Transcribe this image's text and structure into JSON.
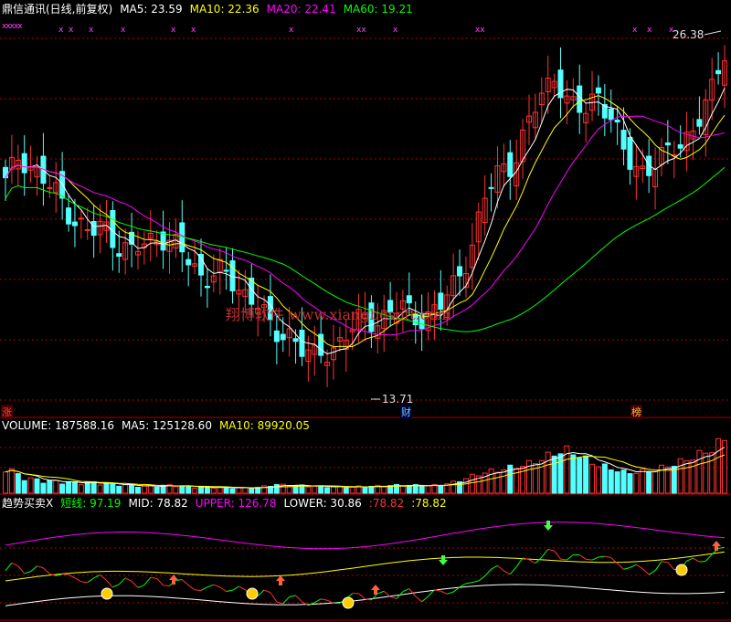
{
  "colors": {
    "bg": "#000000",
    "up": "#ff3232",
    "down": "#54ffff",
    "ma5": "#ffffff",
    "ma10": "#ffff00",
    "ma20": "#ff00ff",
    "ma60": "#00ff00",
    "grid": "#b00000",
    "label": "#d0d0d0",
    "wm": "#c03030"
  },
  "header": {
    "name": "鼎信通讯(日线,前复权)",
    "ma5": "MA5: 23.59",
    "ma10": "MA10: 22.36",
    "ma20": "MA20: 22.41",
    "ma60": "MA60: 19.21"
  },
  "markers": {
    "top_left": "xxxxx",
    "x_marks": [
      "x",
      "x",
      "x",
      "x",
      "x",
      "x",
      "x",
      "xx",
      "x",
      "xx",
      "x",
      "x",
      "x"
    ]
  },
  "price_annotations": {
    "high": "26.38",
    "low": "13.71"
  },
  "event_flags": {
    "zhang": "涨",
    "cai": "财",
    "bang": "榜"
  },
  "watermark": "翔博软件 www.xiangbosoft.com",
  "volume_header": {
    "volume": "VOLUME: 187588.16",
    "ma5": "MA5: 125128.60",
    "ma10": "MA10: 89920.05"
  },
  "indicator_header": {
    "name": "趋势买卖X",
    "short": "短线: 97.19",
    "mid": "MID: 78.82",
    "upper": "UPPER: 126.78",
    "lower": "LOWER: 30.86",
    "v1": ":78.82",
    "v2": ":78.82"
  },
  "chart_data": [
    {
      "type": "candlestick",
      "title": "鼎信通讯(日线,前复权)",
      "ylim": [
        12.5,
        27.5
      ],
      "ma_values": {
        "MA5": 23.59,
        "MA10": 22.36,
        "MA20": 22.41,
        "MA60": 19.21
      },
      "series_close_approx": [
        21.2,
        22.4,
        21.8,
        21.1,
        20.6,
        19.8,
        19.2,
        19.6,
        18.9,
        18.5,
        18.9,
        19.3,
        18.8,
        18.2,
        17.6,
        17.9,
        17.3,
        17.0,
        16.7,
        15.1,
        15.6,
        14.9,
        14.3,
        14.8,
        15.3,
        15.8,
        15.9,
        16.2,
        16.4,
        16.0,
        16.2,
        16.5,
        17.4,
        18.8,
        20.6,
        21.7,
        22.1,
        23.4,
        24.6,
        25.6,
        24.2,
        23.9,
        24.9,
        23.7,
        22.1,
        21.8,
        22.0,
        22.3,
        22.9,
        23.6,
        24.5,
        26.4
      ],
      "extremes": {
        "high": 26.38,
        "low": 13.71
      }
    },
    {
      "type": "bar",
      "title": "VOLUME",
      "values_approx": [
        95000,
        60000,
        48000,
        42000,
        40000,
        36000,
        38000,
        34000,
        30000,
        26000,
        24000,
        26000,
        28000,
        22000,
        20000,
        21000,
        19000,
        18000,
        20000,
        30000,
        28000,
        26000,
        24000,
        22000,
        21000,
        23000,
        24000,
        26000,
        28000,
        27000,
        26000,
        30000,
        40000,
        58000,
        72000,
        80000,
        90000,
        100000,
        118000,
        140000,
        150000,
        120000,
        98000,
        85000,
        70000,
        75000,
        80000,
        95000,
        110000,
        130000,
        150000,
        187588.16
      ],
      "ma_values": {
        "MA5": 125128.6,
        "MA10": 89920.05
      }
    },
    {
      "type": "line",
      "title": "趋势买卖X",
      "series": [
        {
          "name": "短线",
          "last": 97.19
        },
        {
          "name": "MID",
          "last": 78.82
        },
        {
          "name": "UPPER",
          "last": 126.78
        },
        {
          "name": "LOWER",
          "last": 30.86
        }
      ]
    }
  ]
}
